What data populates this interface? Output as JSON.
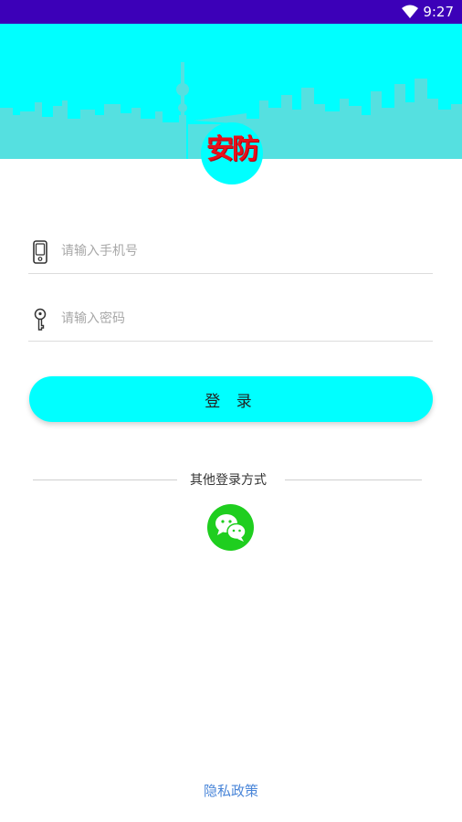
{
  "status_bar": {
    "time": "9:27",
    "wifi_icon": "wifi-icon"
  },
  "header": {
    "logo_text": "安防",
    "colors": {
      "banner": "#00ffff",
      "skyline": "#55e0e0",
      "logo_text": "#e8101a"
    }
  },
  "login_form": {
    "phone": {
      "placeholder": "请输入手机号",
      "value": "",
      "icon": "phone-icon"
    },
    "password": {
      "placeholder": "请输入密码",
      "value": "",
      "icon": "key-icon"
    },
    "submit_label": "登 录"
  },
  "other_login": {
    "label": "其他登录方式",
    "wechat_icon": "wechat-icon"
  },
  "footer": {
    "privacy_label": "隐私政策"
  },
  "colors": {
    "status_bar": "#3c00b8",
    "accent": "#00ffff",
    "wechat": "#1fce1f",
    "link": "#4a86d8"
  }
}
